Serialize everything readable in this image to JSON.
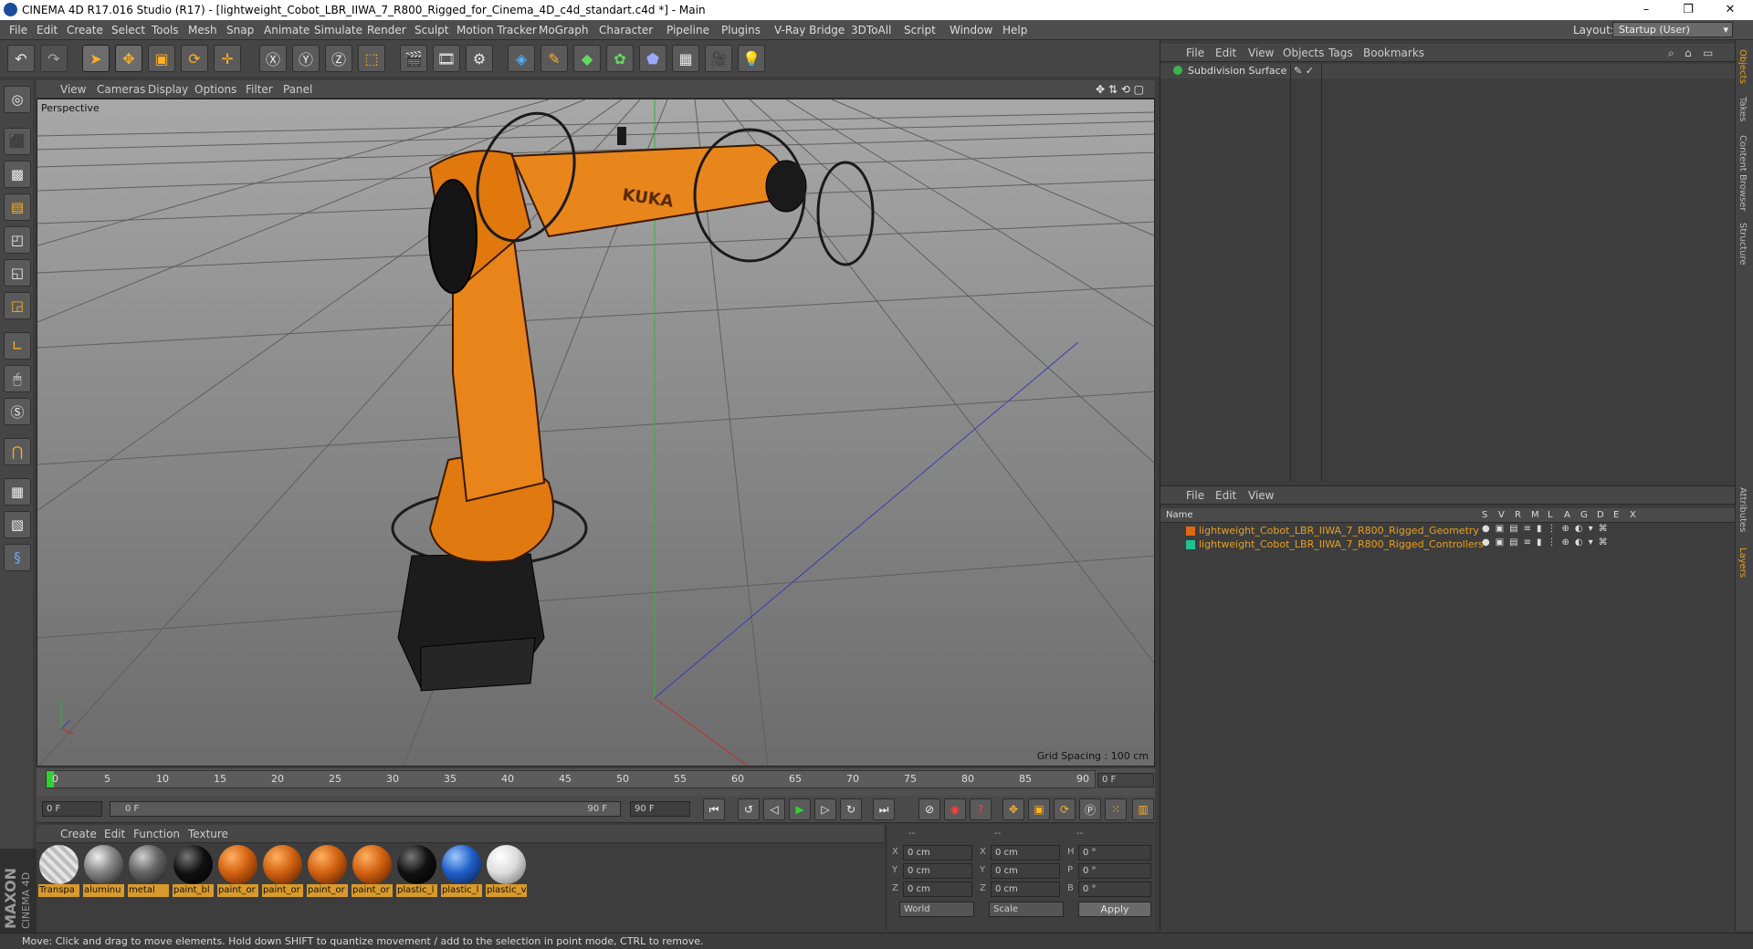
{
  "title": "CINEMA 4D R17.016 Studio (R17) - [lightweight_Cobot_LBR_IIWA_7_R800_Rigged_for_Cinema_4D_c4d_standart.c4d *] - Main",
  "window_controls": {
    "minimize": "–",
    "restore": "❐",
    "close": "✕"
  },
  "menu": [
    "File",
    "Edit",
    "Create",
    "Select",
    "Tools",
    "Mesh",
    "Snap",
    "Animate",
    "Simulate",
    "Render",
    "Sculpt",
    "Motion Tracker",
    "MoGraph",
    "Character",
    "Pipeline",
    "Plugins",
    "V-Ray Bridge",
    "3DToAll",
    "Script",
    "Window",
    "Help"
  ],
  "layout": {
    "label": "Layout:",
    "value": "Startup (User)"
  },
  "viewport": {
    "menu": [
      "View",
      "Cameras",
      "Display",
      "Options",
      "Filter",
      "Panel"
    ],
    "label": "Perspective",
    "grid_spacing": "Grid Spacing : 100 cm",
    "robot_logo": "KUKA"
  },
  "timeline": {
    "ticks": [
      "0",
      "5",
      "10",
      "15",
      "20",
      "25",
      "30",
      "35",
      "40",
      "45",
      "50",
      "55",
      "60",
      "65",
      "70",
      "75",
      "80",
      "85",
      "90"
    ],
    "current_frame": "0 F",
    "start": "0 F",
    "range_start": "0 F",
    "range_end": "90 F",
    "end": "90 F"
  },
  "material_manager": {
    "menu": [
      "Create",
      "Edit",
      "Function",
      "Texture"
    ],
    "materials": [
      {
        "label": "Transpa",
        "color": "#d0d0d0"
      },
      {
        "label": "aluminu",
        "color": "#8a8a8a"
      },
      {
        "label": "metal",
        "color": "#6a6a6a"
      },
      {
        "label": "paint_bl",
        "color": "#111111"
      },
      {
        "label": "paint_or",
        "color": "#d06010"
      },
      {
        "label": "paint_or",
        "color": "#d06010"
      },
      {
        "label": "paint_or",
        "color": "#d06010"
      },
      {
        "label": "paint_or",
        "color": "#d06010"
      },
      {
        "label": "plastic_l",
        "color": "#111111"
      },
      {
        "label": "plastic_l",
        "color": "#1f5fc8"
      },
      {
        "label": "plastic_v",
        "color": "#e6e6e6"
      }
    ]
  },
  "coordinates": {
    "headers": [
      "--",
      "--",
      "--"
    ],
    "rows": [
      {
        "a": "X",
        "av": "0 cm",
        "b": "X",
        "bv": "0 cm",
        "c": "H",
        "cv": "0 °"
      },
      {
        "a": "Y",
        "av": "0 cm",
        "b": "Y",
        "bv": "0 cm",
        "c": "P",
        "cv": "0 °"
      },
      {
        "a": "Z",
        "av": "0 cm",
        "b": "Z",
        "bv": "0 cm",
        "c": "B",
        "cv": "0 °"
      }
    ],
    "mode": "World",
    "scale": "Scale",
    "apply": "Apply"
  },
  "object_manager": {
    "menu": [
      "File",
      "Edit",
      "View",
      "Objects",
      "Tags",
      "Bookmarks"
    ],
    "objects": [
      {
        "name": "Subdivision Surface"
      }
    ]
  },
  "layer_manager": {
    "menu": [
      "File",
      "Edit",
      "View"
    ],
    "columns": [
      "Name",
      "S",
      "V",
      "R",
      "M",
      "L",
      "A",
      "G",
      "D",
      "E",
      "X"
    ],
    "layers": [
      {
        "name": "lightweight_Cobot_LBR_IIWA_7_R800_Rigged_Geometry",
        "color": "#e06a10"
      },
      {
        "name": "lightweight_Cobot_LBR_IIWA_7_R800_Rigged_Controllers",
        "color": "#20c090"
      }
    ]
  },
  "right_tabs": [
    "Objects",
    "Takes",
    "Content Browser",
    "Structure",
    "Attributes",
    "Layers"
  ],
  "brand": {
    "line1": "MAXON",
    "line2": "CINEMA 4D"
  },
  "status": "Move: Click and drag to move elements. Hold down SHIFT to quantize movement / add to the selection in point mode, CTRL to remove."
}
